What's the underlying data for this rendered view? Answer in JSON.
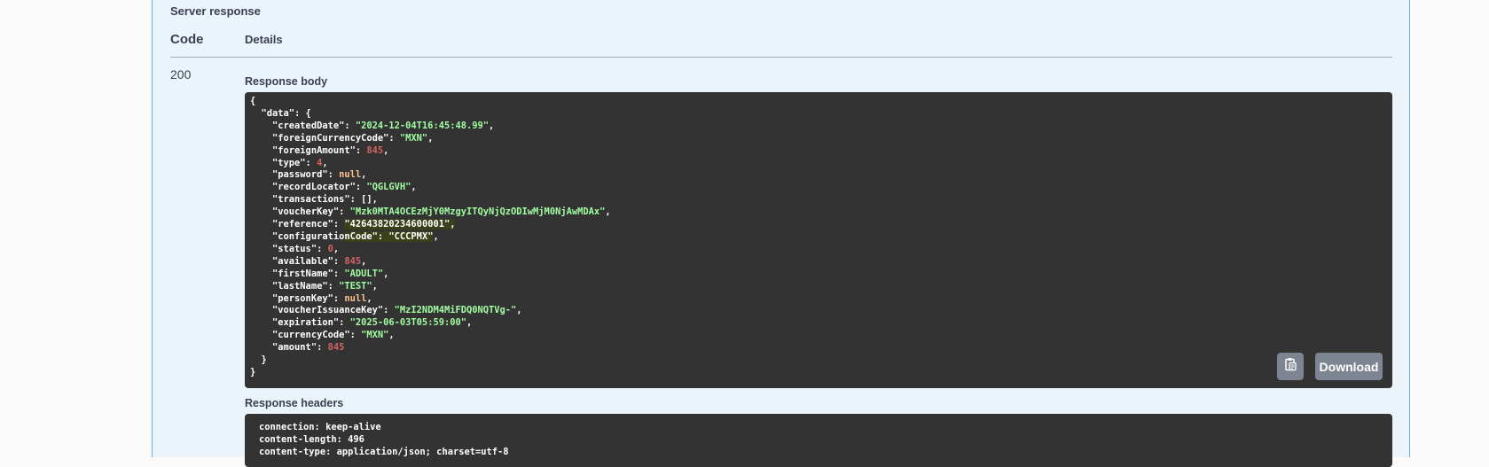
{
  "response": {
    "section_title": "Server response",
    "col_code": "Code",
    "col_details": "Details",
    "status_code": "200",
    "body_heading": "Response body",
    "headers_heading": "Response headers",
    "download_label": "Download",
    "copy_icon": "clipboard-icon",
    "body_lines": [
      [
        {
          "t": "{",
          "c": "k"
        }
      ],
      [
        {
          "t": "  \"data\": {",
          "c": "k"
        }
      ],
      [
        {
          "t": "    \"createdDate\": ",
          "c": "k"
        },
        {
          "t": "\"2024-12-04T16:45:48.99\"",
          "c": "s"
        },
        {
          "t": ",",
          "c": "k"
        }
      ],
      [
        {
          "t": "    \"foreignCurrencyCode\": ",
          "c": "k"
        },
        {
          "t": "\"MXN\"",
          "c": "s"
        },
        {
          "t": ",",
          "c": "k"
        }
      ],
      [
        {
          "t": "    \"foreignAmount\": ",
          "c": "k"
        },
        {
          "t": "845",
          "c": "n"
        },
        {
          "t": ",",
          "c": "k"
        }
      ],
      [
        {
          "t": "    \"type\": ",
          "c": "k"
        },
        {
          "t": "4",
          "c": "n"
        },
        {
          "t": ",",
          "c": "k"
        }
      ],
      [
        {
          "t": "    \"password\": ",
          "c": "k"
        },
        {
          "t": "null",
          "c": "nl"
        },
        {
          "t": ",",
          "c": "k"
        }
      ],
      [
        {
          "t": "    \"recordLocator\": ",
          "c": "k"
        },
        {
          "t": "\"QGLGVH\"",
          "c": "s"
        },
        {
          "t": ",",
          "c": "k"
        }
      ],
      [
        {
          "t": "    \"transactions\": [],",
          "c": "k"
        }
      ],
      [
        {
          "t": "    \"voucherKey\": ",
          "c": "k"
        },
        {
          "t": "\"Mzk0MTA4OCEzMjY0MzgyITQyNjQzODIwMjM0NjAwMDAx\"",
          "c": "s"
        },
        {
          "t": ",",
          "c": "k"
        }
      ],
      [
        {
          "t": "    \"reference\": ",
          "c": "k"
        },
        {
          "t": "\"42643820234600001\",",
          "c": "s",
          "hl": true
        }
      ],
      [
        {
          "t": "    \"configuratio",
          "c": "k"
        },
        {
          "t": "nCode\": ",
          "c": "k",
          "hl": true
        },
        {
          "t": "\"CCCPMX\"",
          "c": "s",
          "hl": true
        },
        {
          "t": ",",
          "c": "k"
        }
      ],
      [
        {
          "t": "    \"status\": ",
          "c": "k"
        },
        {
          "t": "0",
          "c": "n"
        },
        {
          "t": ",",
          "c": "k"
        }
      ],
      [
        {
          "t": "    \"available\": ",
          "c": "k"
        },
        {
          "t": "845",
          "c": "n"
        },
        {
          "t": ",",
          "c": "k"
        }
      ],
      [
        {
          "t": "    \"firstName\": ",
          "c": "k"
        },
        {
          "t": "\"ADULT\"",
          "c": "s"
        },
        {
          "t": ",",
          "c": "k"
        }
      ],
      [
        {
          "t": "    \"lastName\": ",
          "c": "k"
        },
        {
          "t": "\"TEST\"",
          "c": "s"
        },
        {
          "t": ",",
          "c": "k"
        }
      ],
      [
        {
          "t": "    \"personKey\": ",
          "c": "k"
        },
        {
          "t": "null",
          "c": "nl"
        },
        {
          "t": ",",
          "c": "k"
        }
      ],
      [
        {
          "t": "    \"voucherIssuanceKey\": ",
          "c": "k"
        },
        {
          "t": "\"MzI2NDM4MiFDQ0NQTVg-\"",
          "c": "s"
        },
        {
          "t": ",",
          "c": "k"
        }
      ],
      [
        {
          "t": "    \"expiration\": ",
          "c": "k"
        },
        {
          "t": "\"2025-06-03T05:59:00\"",
          "c": "s"
        },
        {
          "t": ",",
          "c": "k"
        }
      ],
      [
        {
          "t": "    \"currencyCode\": ",
          "c": "k"
        },
        {
          "t": "\"MXN\"",
          "c": "s"
        },
        {
          "t": ",",
          "c": "k"
        }
      ],
      [
        {
          "t": "    \"amount\": ",
          "c": "k"
        },
        {
          "t": "845",
          "c": "n"
        }
      ],
      [
        {
          "t": "  }",
          "c": "k"
        }
      ],
      [
        {
          "t": "}",
          "c": "k"
        }
      ]
    ],
    "header_lines": [
      "connection: keep-alive",
      "content-length: 496",
      "content-type: application/json; charset=utf-8"
    ]
  }
}
